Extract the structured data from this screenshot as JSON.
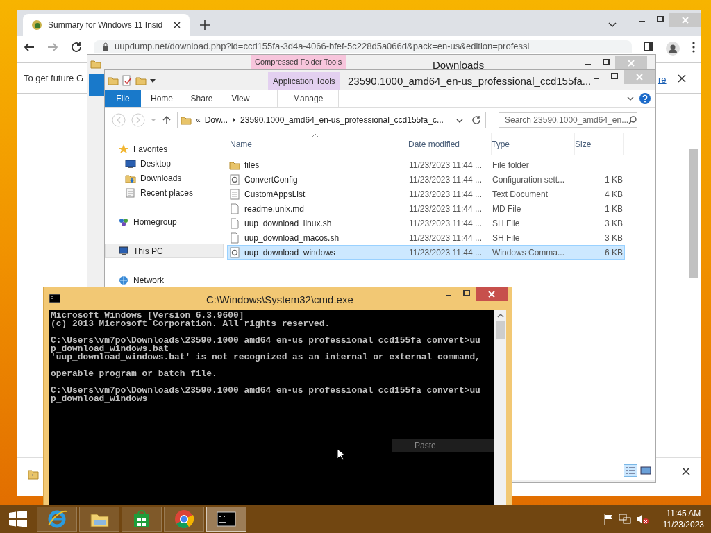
{
  "browser": {
    "tab_title": "Summary for Windows 11 Insid",
    "url": "uupdump.net/download.php?id=ccd155fa-3d4a-4066-bfef-5c228d5a066d&pack=en-us&edition=professi",
    "infobar_text": "To get future G",
    "infobar_link": "re"
  },
  "back_explorer": {
    "context_tab": "Compressed Folder Tools",
    "title": "Downloads"
  },
  "explorer": {
    "context_tab": "Application Tools",
    "title": "23590.1000_amd64_en-us_professional_ccd155fa...",
    "ribbon_tabs": [
      {
        "label": "File",
        "selected": true
      },
      {
        "label": "Home",
        "selected": false
      },
      {
        "label": "Share",
        "selected": false
      },
      {
        "label": "View",
        "selected": false
      },
      {
        "label": "Manage",
        "selected": false
      }
    ],
    "address": {
      "chevron": "«",
      "crumbs": [
        "Dow...",
        "23590.1000_amd64_en-us_professional_ccd155fa_c..."
      ]
    },
    "search": {
      "placeholder": "Search 23590.1000_amd64_en..."
    },
    "nav": [
      {
        "label": "Favorites",
        "kind": "favorites",
        "selected": false,
        "children": [
          {
            "label": "Desktop",
            "kind": "desktop",
            "selected": false
          },
          {
            "label": "Downloads",
            "kind": "downloads",
            "selected": false
          },
          {
            "label": "Recent places",
            "kind": "recent",
            "selected": false
          }
        ]
      },
      {
        "label": "Homegroup",
        "kind": "homegroup",
        "selected": false
      },
      {
        "label": "This PC",
        "kind": "pc",
        "selected": true
      },
      {
        "label": "Network",
        "kind": "network",
        "selected": false
      }
    ],
    "columns": [
      "Name",
      "Date modified",
      "Type",
      "Size"
    ],
    "rows": [
      {
        "kind": "folder",
        "name": "files",
        "date": "11/23/2023 11:44 ...",
        "type": "File folder",
        "size": "",
        "selected": false
      },
      {
        "kind": "config",
        "name": "ConvertConfig",
        "date": "11/23/2023 11:44 ...",
        "type": "Configuration sett...",
        "size": "1 KB",
        "selected": false
      },
      {
        "kind": "text",
        "name": "CustomAppsList",
        "date": "11/23/2023 11:44 ...",
        "type": "Text Document",
        "size": "4 KB",
        "selected": false
      },
      {
        "kind": "file",
        "name": "readme.unix.md",
        "date": "11/23/2023 11:44 ...",
        "type": "MD File",
        "size": "1 KB",
        "selected": false
      },
      {
        "kind": "file",
        "name": "uup_download_linux.sh",
        "date": "11/23/2023 11:44 ...",
        "type": "SH File",
        "size": "3 KB",
        "selected": false
      },
      {
        "kind": "file",
        "name": "uup_download_macos.sh",
        "date": "11/23/2023 11:44 ...",
        "type": "SH File",
        "size": "3 KB",
        "selected": false
      },
      {
        "kind": "config",
        "name": "uup_download_windows",
        "date": "11/23/2023 11:44 ...",
        "type": "Windows Comma...",
        "size": "6 KB",
        "selected": true
      }
    ]
  },
  "console": {
    "title": "C:\\Windows\\System32\\cmd.exe",
    "blocks": [
      [
        "Microsoft Windows [Version 6.3.9600]",
        "(c) 2013 Microsoft Corporation. All rights reserved."
      ],
      [
        "C:\\Users\\vm7po\\Downloads\\23590.1000_amd64_en-us_professional_ccd155fa_convert>uu",
        "p_download_windows.bat",
        "'uup_download_windows.bat' is not recognized as an internal or external command,"
      ],
      [
        "operable program or batch file."
      ],
      [
        "C:\\Users\\vm7po\\Downloads\\23590.1000_amd64_en-us_professional_ccd155fa_convert>uu",
        "p_download_windows"
      ]
    ],
    "menu_item": "Paste"
  },
  "taskbar": {
    "apps": [
      {
        "kind": "ie",
        "active": false
      },
      {
        "kind": "explorer",
        "active": false
      },
      {
        "kind": "store",
        "active": false
      },
      {
        "kind": "chrome",
        "active": false
      },
      {
        "kind": "cmd",
        "active": true
      }
    ],
    "time": "11:45 AM",
    "date": "11/23/2023"
  }
}
